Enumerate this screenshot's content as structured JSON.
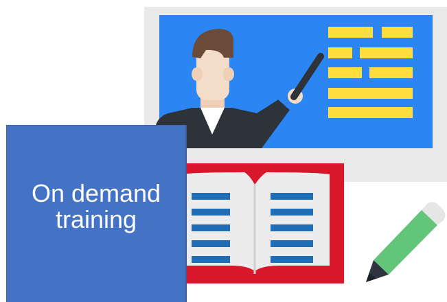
{
  "card": {
    "label": "On demand\ntraining"
  },
  "icons": {
    "board": "whiteboard-presentation-icon",
    "teacher": "teacher-icon",
    "book": "open-book-icon",
    "pencil": "pencil-icon"
  },
  "colors": {
    "card_fill": "#4472c4",
    "board_frame": "#e9e9e9",
    "board_screen": "#2b86f3",
    "board_lines": "#ffdd3c",
    "book_cover": "#d9172a",
    "book_page": "#ececec",
    "book_lines": "#1f6db5",
    "pencil_body": "#63c57a",
    "pencil_tip": "#2f3440",
    "skin": "#f3dcc8",
    "hair": "#6a4b3a",
    "suit": "#2d3338"
  }
}
